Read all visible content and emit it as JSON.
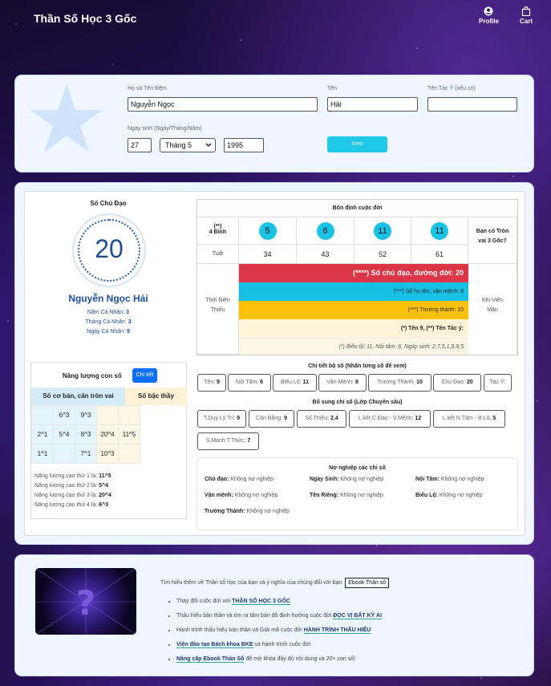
{
  "nav": {
    "brand": "Thần Số Học 3 Gốc",
    "profile": "Profile",
    "cart": "Cart"
  },
  "form": {
    "label_hoten": "Họ và Tên Đệm",
    "value_hoten": "Nguyễn Ngọc",
    "label_ten": "Tên",
    "value_ten": "Hải",
    "label_tacy": "Tên Tác Ý (nếu có)",
    "value_tacy": "",
    "label_ngaysinh": "Ngày sinh (Ngày/Tháng/Năm)",
    "day": "27",
    "month": "Tháng 5",
    "year": "1995",
    "btn": "Xem"
  },
  "core": {
    "title": "Số Chủ Đạo",
    "number": "20",
    "name": "Nguyễn Ngọc Hải",
    "nam_label": "Năm Cá Nhân:",
    "nam": "3",
    "thang_label": "Tháng Cá Nhân:",
    "thang": "3",
    "ngay_label": "Ngày Cá Nhân:",
    "ngay": "9"
  },
  "energy": {
    "title": "Năng lượng con số",
    "btn": "Chi tiết",
    "head_left": "Số cơ bản, căn tròn vai",
    "head_right": "Số bậc thầy",
    "rows": [
      [
        "",
        "6^3",
        "9^3",
        "",
        ""
      ],
      [
        "2^1",
        "5^4",
        "8^3",
        "20^4",
        "11^5"
      ],
      [
        "1^1",
        "",
        "7^1",
        "10^3",
        ""
      ]
    ],
    "levels": [
      {
        "label": "Năng lượng cao thứ 1 là:",
        "value": "11^5"
      },
      {
        "label": "Năng lượng cao thứ 2 là:",
        "value": "5^4"
      },
      {
        "label": "Năng lượng cao thứ 3 là:",
        "value": "20^4"
      },
      {
        "label": "Năng lượng cao thứ 4 là:",
        "value": "6^3"
      }
    ]
  },
  "peaks": {
    "title": "Bốn đỉnh cuộc đời",
    "row_label_1": "(**)",
    "row_label_2": "4 Đỉnh",
    "tuoi_label": "Tuổi",
    "peaks": [
      "5",
      "6",
      "11",
      "11"
    ],
    "ages": [
      "34",
      "43",
      "52",
      "61"
    ],
    "side_right": "Bạn có Tròn vai 3 Gốc?",
    "left_block": "Thời Niên Thiếu",
    "right_block": "Khi Viên Mãn",
    "bar1": "(****) Số chủ đạo, đường đời: 20",
    "bar2": "(***) Số họ tên, vận mệnh: 8",
    "bar3": "(***) Trưởng thành: 10",
    "bar4": "(*) Tên 9, (**) Tên Tác ý:",
    "bar5": "(*) Biểu lộ: 11, Nội tâm: 6, Ngày sinh: 2,7,5,1,9,9,5"
  },
  "detail": {
    "title": "Chi tiết bộ số (Nhấn từng số để xem)",
    "items": [
      {
        "l": "Tên:",
        "v": "9"
      },
      {
        "l": "Nội Tâm:",
        "v": "6"
      },
      {
        "l": "Biểu Lộ:",
        "v": "11"
      },
      {
        "l": "Vận Mệnh:",
        "v": "8"
      },
      {
        "l": "Trưởng Thành:",
        "v": "10"
      },
      {
        "l": "Chủ Đạo:",
        "v": "20"
      },
      {
        "l": "Tác Ý:",
        "v": ""
      }
    ]
  },
  "extra": {
    "title": "Bổ sung chỉ số (Lớp Chuyên sâu)",
    "items": [
      {
        "l": "T.Duy Lý Trí:",
        "v": "9"
      },
      {
        "l": "Cân Bằng:",
        "v": "9"
      },
      {
        "l": "Số Thiếu:",
        "v": "2,4"
      },
      {
        "l": "L.kết C.Đạo - V.Mệnh:",
        "v": "12"
      },
      {
        "l": "L.kết N.Tâm - B.Lộ:",
        "v": "5"
      },
      {
        "l": "S.Mạnh T.Thức:",
        "v": "7"
      }
    ]
  },
  "debt": {
    "title": "Nợ nghiệp các chỉ số",
    "items": [
      {
        "l": "Chủ đạo:",
        "v": "Không nợ nghiệp"
      },
      {
        "l": "Ngày Sinh:",
        "v": "Không nợ nghiệp"
      },
      {
        "l": "Nội Tâm:",
        "v": "Không nợ nghiệp"
      },
      {
        "l": "Vận mệnh:",
        "v": "Không nợ nghiệp"
      },
      {
        "l": "Tên Riêng:",
        "v": "Không nợ nghiệp"
      },
      {
        "l": "Biểu Lộ:",
        "v": "Không nợ nghiệp"
      },
      {
        "l": "Trưởng Thành:",
        "v": "Không nợ nghiệp"
      }
    ]
  },
  "footer": {
    "intro": "Tìm hiểu thêm về Thần số học của bạn và ý nghĩa của chúng đối với bạn",
    "ebook": "Ebook Thần số",
    "l1a": "Thay đổi cuộc đời với",
    "l1b": "THẦN SỐ HỌC 3 GỐC",
    "l2a": "Thấu hiểu bản thân và tìm ra tấm bản đồ định hướng cuộc đời",
    "l2b": "ĐỌC VỊ BẤT KỲ AI",
    "l3a": "Hành trình thấu hiểu bản thân và Giải mã cuộc đời",
    "l3b": "HÀNH TRÌNH THẤU HIỂU",
    "l4a": "Viện đào tạo Bách khoa BKE",
    "l4b": "và hành trình cuộc đời",
    "l5a": "Nâng cấp Ebook Thần Số",
    "l5b": "để mở khóa đầy đủ nội dung và 20+ con số!"
  }
}
